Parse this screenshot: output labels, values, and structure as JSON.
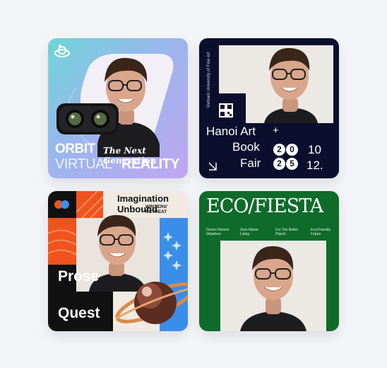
{
  "cards": [
    {
      "id": "orbit",
      "brand_word": "ORBIT",
      "tagline": "The Next Generation",
      "line2_light": "VIRTUAL",
      "line2_bold": "REALITY"
    },
    {
      "id": "hanoi",
      "vertical_text": "Vietnam University of Fine Art",
      "line1": "Hanoi Art",
      "plus": "+",
      "line2": "Book",
      "line3": "Fair",
      "year_digits": [
        "2",
        "0",
        "2",
        "5"
      ],
      "date_top": "10",
      "date_bottom": "12."
    },
    {
      "id": "prose",
      "title_line1": "Imagination",
      "title_line2": "Unbound",
      "small_line1": "WRITERS'",
      "small_line2": "RETREAT",
      "vertical_line1": "Prose",
      "vertical_line2": "Quest"
    },
    {
      "id": "eco",
      "headline": "ECO/FIESTA",
      "captions": [
        "Green Horizon Initiatives",
        "Zero-Waste Living",
        "For The Better Planet",
        "Eco-Friendly Future"
      ]
    }
  ],
  "colors": {
    "page_bg": "#f4f5f8",
    "orbit_gradient": [
      "#6fd6d8",
      "#c0a6f0"
    ],
    "hanoi_bg": "#0b0e2c",
    "prose_orange": "#f0531d",
    "prose_blue": "#3b8ee8",
    "eco_green": "#0f6b2a"
  }
}
